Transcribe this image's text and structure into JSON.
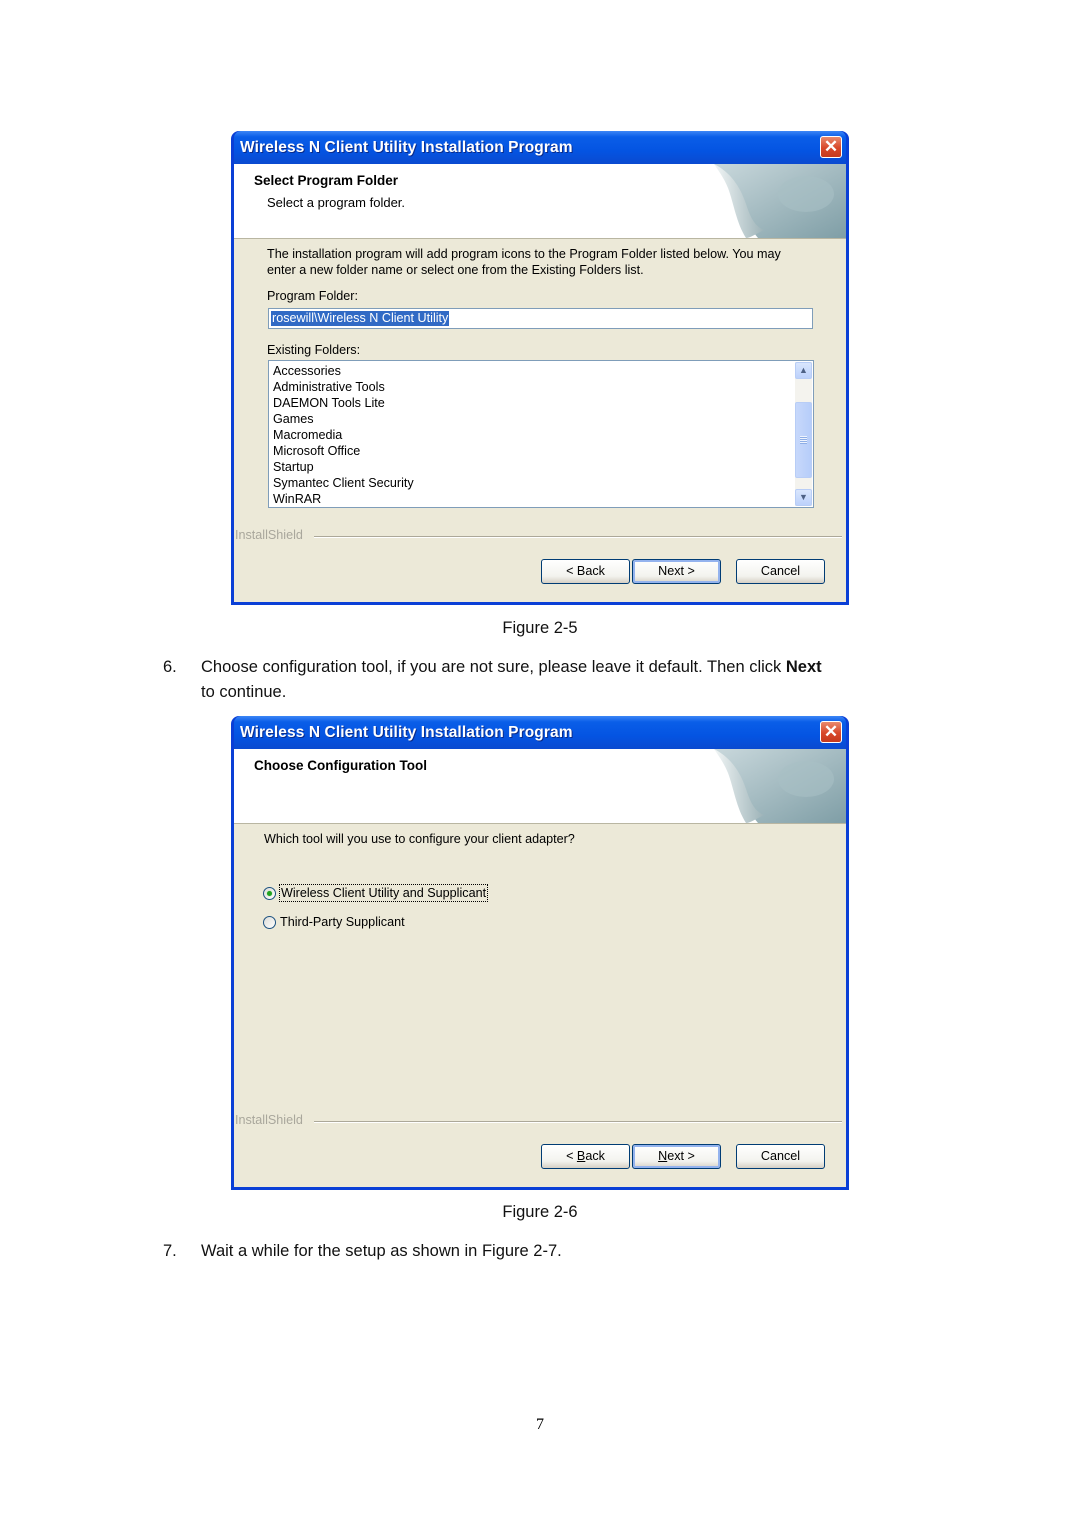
{
  "figure_5": {
    "window_title": "Wireless N Client Utility Installation Program",
    "close_icon": "close-icon",
    "header_title": "Select Program Folder",
    "header_subtitle": "Select a program folder.",
    "description_line1": "The installation program will add program icons to the Program Folder listed below. You may",
    "description_line2": "enter a new folder name or select one from the Existing Folders list.",
    "program_folder_label": "Program Folder:",
    "program_folder_value": "rosewill\\Wireless N Client Utility",
    "existing_folders_label": "Existing Folders:",
    "existing_folders": [
      "Accessories",
      "Administrative Tools",
      "DAEMON Tools Lite",
      "Games",
      "Macromedia",
      "Microsoft Office",
      "Startup",
      "Symantec Client Security",
      "WinRAR"
    ],
    "brand_label": "InstallShield",
    "buttons": {
      "back": "< Back",
      "next": "Next >",
      "cancel": "Cancel"
    },
    "caption": "Figure 2-5"
  },
  "step_6": {
    "number": "6.",
    "text_before_bold": "Choose configuration tool, if you are not sure, please leave it default. Then click ",
    "bold": "Next",
    "text_line2": "to continue."
  },
  "figure_6": {
    "window_title": "Wireless N Client Utility Installation Program",
    "header_title": "Choose Configuration Tool",
    "question": "Which tool will you use to configure your client adapter?",
    "options": [
      {
        "label": "Wireless Client Utility and Supplicant",
        "selected": true
      },
      {
        "label": "Third-Party Supplicant",
        "selected": false
      }
    ],
    "brand_label": "InstallShield",
    "buttons": {
      "back_prefix": "< ",
      "back_mnemonic": "B",
      "back_rest": "ack",
      "next_mnemonic": "N",
      "next_rest": "ext >",
      "cancel": "Cancel"
    },
    "caption": "Figure 2-6"
  },
  "step_7": {
    "number": "7.",
    "text": "Wait a while for the setup as shown in Figure 2-7."
  },
  "page_number": "7"
}
